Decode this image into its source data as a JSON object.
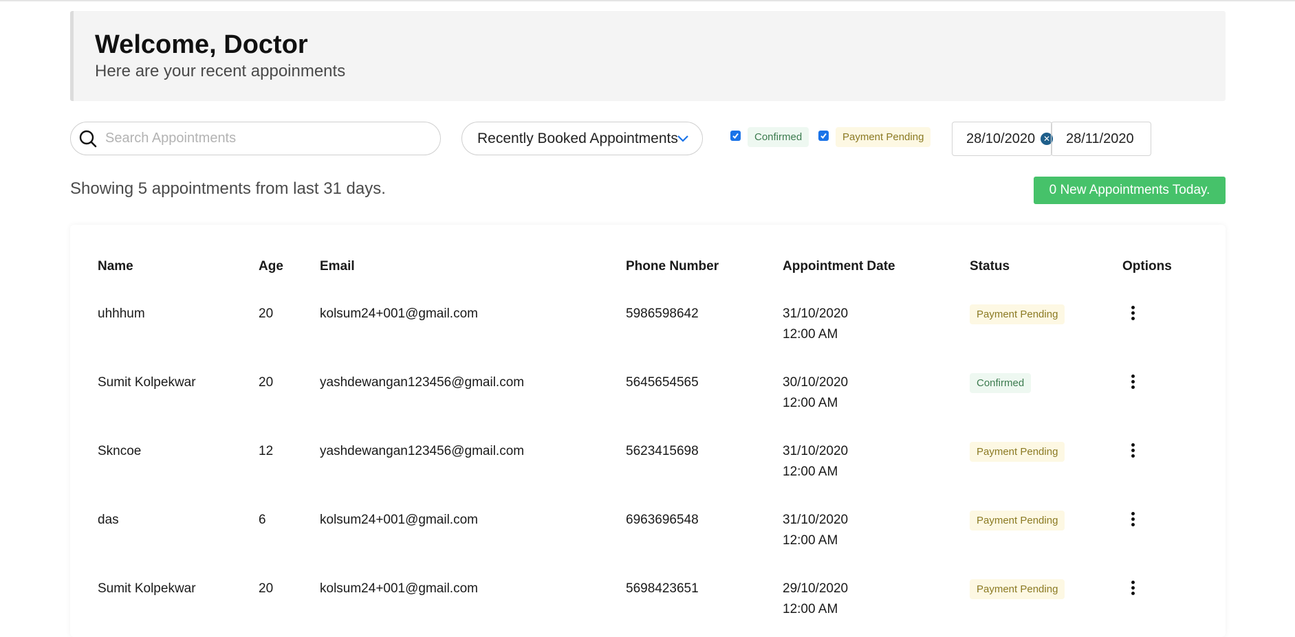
{
  "header": {
    "title": "Welcome, Doctor",
    "subtitle": "Here are your recent appoinments"
  },
  "toolbar": {
    "search_placeholder": "Search Appointments",
    "sort_selected": "Recently Booked Appointments",
    "filters": [
      {
        "label": "Confirmed",
        "checked": true
      },
      {
        "label": "Payment Pending",
        "checked": true
      }
    ],
    "date_from": "28/10/2020",
    "date_to": "28/11/2020"
  },
  "summary": "Showing 5 appointments from last 31 days.",
  "new_today_label": "0 New Appointments Today.",
  "table": {
    "columns": [
      "Name",
      "Age",
      "Email",
      "Phone Number",
      "Appointment Date",
      "Status",
      "Options"
    ],
    "rows": [
      {
        "name": "uhhhum",
        "age": "20",
        "email": "kolsum24+001@gmail.com",
        "phone": "5986598642",
        "date": "31/10/2020",
        "time": "12:00 AM",
        "status": "Payment Pending"
      },
      {
        "name": "Sumit Kolpekwar",
        "age": "20",
        "email": "yashdewangan123456@gmail.com",
        "phone": "5645654565",
        "date": "30/10/2020",
        "time": "12:00 AM",
        "status": "Confirmed"
      },
      {
        "name": "Skncoe",
        "age": "12",
        "email": "yashdewangan123456@gmail.com",
        "phone": "5623415698",
        "date": "31/10/2020",
        "time": "12:00 AM",
        "status": "Payment Pending"
      },
      {
        "name": "das",
        "age": "6",
        "email": "kolsum24+001@gmail.com",
        "phone": "6963696548",
        "date": "31/10/2020",
        "time": "12:00 AM",
        "status": "Payment Pending"
      },
      {
        "name": "Sumit Kolpekwar",
        "age": "20",
        "email": "kolsum24+001@gmail.com",
        "phone": "5698423651",
        "date": "29/10/2020",
        "time": "12:00 AM",
        "status": "Payment Pending"
      }
    ]
  },
  "colors": {
    "accent_green": "#46c26a",
    "confirmed_bg": "#eef8f1",
    "pending_bg": "#fdf8e3",
    "checkbox_blue": "#1a73e8"
  }
}
